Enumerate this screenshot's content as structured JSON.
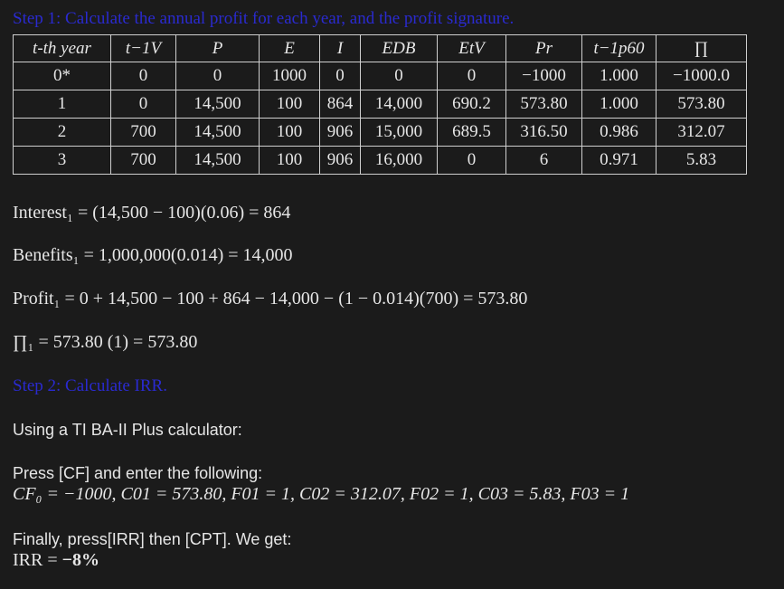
{
  "step1": {
    "title": "Step 1: Calculate the annual profit for each year, and the profit signature."
  },
  "table": {
    "headers": [
      "t-th year",
      "t−1V",
      "P",
      "E",
      "I",
      "EDB",
      "EtV",
      "Pr",
      "t−1p60",
      "∏"
    ],
    "rows": [
      [
        "0*",
        "0",
        "0",
        "1000",
        "0",
        "0",
        "0",
        "−1000",
        "1.000",
        "−1000.0"
      ],
      [
        "1",
        "0",
        "14,500",
        "100",
        "864",
        "14,000",
        "690.2",
        "573.80",
        "1.000",
        "573.80"
      ],
      [
        "2",
        "700",
        "14,500",
        "100",
        "906",
        "15,000",
        "689.5",
        "316.50",
        "0.986",
        "312.07"
      ],
      [
        "3",
        "700",
        "14,500",
        "100",
        "906",
        "16,000",
        "0",
        "6",
        "0.971",
        "5.83"
      ]
    ]
  },
  "equations": {
    "interest": "Interest₁ = (14,500 − 100)(0.06) = 864",
    "benefits": "Benefits₁ = 1,000,000(0.014) = 14,000",
    "profit": "Profit₁ = 0 + 14,500 − 100 + 864 − 14,000 − (1 − 0.014)(700) = 573.80",
    "pi": "∏₁ = 573.80 (1) = 573.80"
  },
  "step2": {
    "title": "Step 2: Calculate IRR."
  },
  "text": {
    "calculator": "Using a TI BA-II Plus calculator:",
    "press": "Press [CF] and enter the following:",
    "cf_values": "CF₀ = −1000, C01 = 573.80, F01 = 1, C02 = 312.07, F02 = 1, C03 = 5.83, F03 = 1",
    "finally": "Finally, press[IRR] then [CPT]. We get:",
    "irr_label": "IRR = ",
    "irr_value": "−8%"
  },
  "colors": {
    "background": "#1b1b1b",
    "text": "#e6e6e6",
    "step_heading": "#2a2ad0"
  }
}
